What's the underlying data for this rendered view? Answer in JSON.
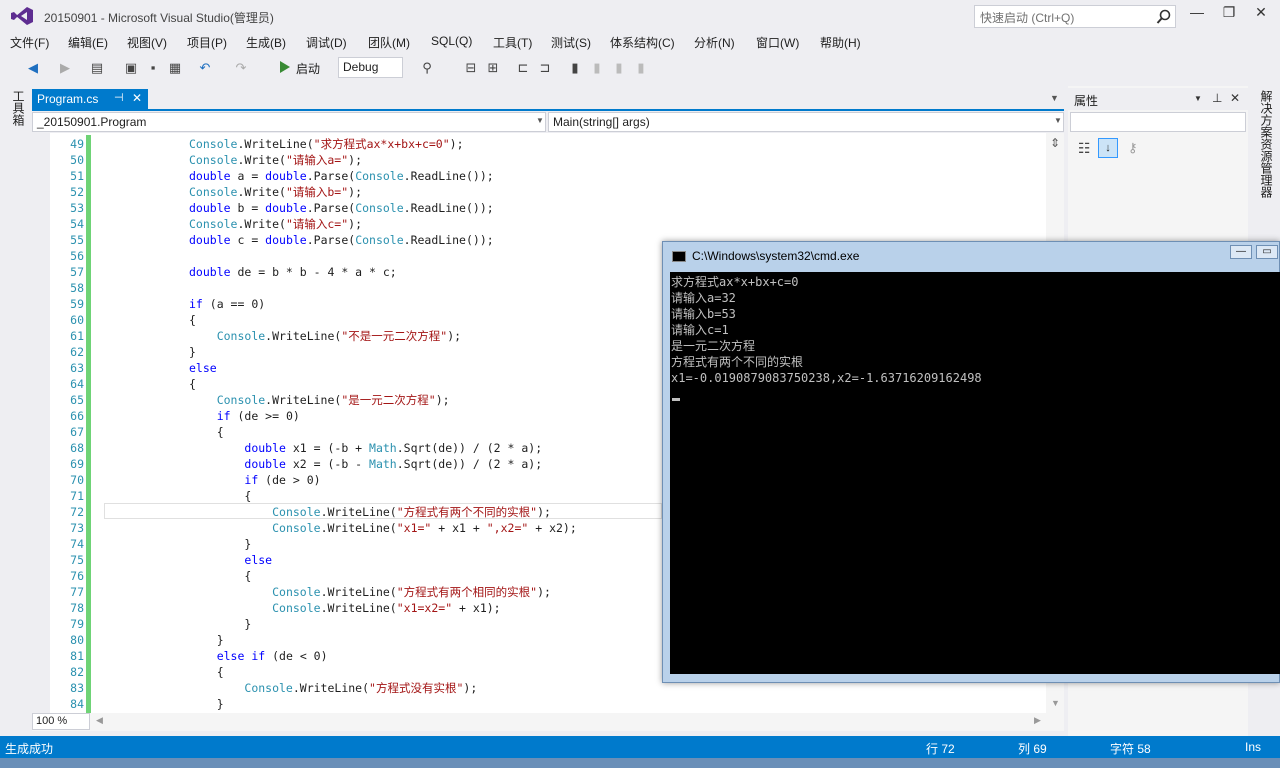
{
  "title_bar": {
    "title": "20150901 - Microsoft Visual Studio(管理员)",
    "quick_launch_placeholder": "快速启动 (Ctrl+Q)"
  },
  "menu": [
    "文件(F)",
    "编辑(E)",
    "视图(V)",
    "项目(P)",
    "生成(B)",
    "调试(D)",
    "团队(M)",
    "SQL(Q)",
    "工具(T)",
    "测试(S)",
    "体系结构(C)",
    "分析(N)",
    "窗口(W)",
    "帮助(H)"
  ],
  "toolbar": {
    "start_label": "启动",
    "config": "Debug"
  },
  "toolbox_label": "工具箱",
  "tab": {
    "label": "Program.cs"
  },
  "nav": {
    "left": "_20150901.Program",
    "right": "Main(string[] args)"
  },
  "editor": {
    "zoom": "100 %",
    "lines": [
      {
        "n": "49",
        "code": "Console.WriteLine(\"求方程式ax*x+bx+c=0\");"
      },
      {
        "n": "50",
        "code": "Console.Write(\"请输入a=\");"
      },
      {
        "n": "51",
        "code": "double a = double.Parse(Console.ReadLine());"
      },
      {
        "n": "52",
        "code": "Console.Write(\"请输入b=\");"
      },
      {
        "n": "53",
        "code": "double b = double.Parse(Console.ReadLine());"
      },
      {
        "n": "54",
        "code": "Console.Write(\"请输入c=\");"
      },
      {
        "n": "55",
        "code": "double c = double.Parse(Console.ReadLine());"
      },
      {
        "n": "56",
        "code": ""
      },
      {
        "n": "57",
        "code": "double de = b * b - 4 * a * c;"
      },
      {
        "n": "58",
        "code": ""
      },
      {
        "n": "59",
        "code": "if (a == 0)"
      },
      {
        "n": "60",
        "code": "{"
      },
      {
        "n": "61",
        "code": "    Console.WriteLine(\"不是一元二次方程\");"
      },
      {
        "n": "62",
        "code": "}"
      },
      {
        "n": "63",
        "code": "else"
      },
      {
        "n": "64",
        "code": "{"
      },
      {
        "n": "65",
        "code": "    Console.WriteLine(\"是一元二次方程\");"
      },
      {
        "n": "66",
        "code": "    if (de >= 0)"
      },
      {
        "n": "67",
        "code": "    {"
      },
      {
        "n": "68",
        "code": "        double x1 = (-b + Math.Sqrt(de)) / (2 * a);"
      },
      {
        "n": "69",
        "code": "        double x2 = (-b - Math.Sqrt(de)) / (2 * a);"
      },
      {
        "n": "70",
        "code": "        if (de > 0)"
      },
      {
        "n": "71",
        "code": "        {"
      },
      {
        "n": "72",
        "code": "            Console.WriteLine(\"方程式有两个不同的实根\");"
      },
      {
        "n": "73",
        "code": "            Console.WriteLine(\"x1=\" + x1 + \",x2=\" + x2);"
      },
      {
        "n": "74",
        "code": "        }"
      },
      {
        "n": "75",
        "code": "        else"
      },
      {
        "n": "76",
        "code": "        {"
      },
      {
        "n": "77",
        "code": "            Console.WriteLine(\"方程式有两个相同的实根\");"
      },
      {
        "n": "78",
        "code": "            Console.WriteLine(\"x1=x2=\" + x1);"
      },
      {
        "n": "79",
        "code": "        }"
      },
      {
        "n": "80",
        "code": "    }"
      },
      {
        "n": "81",
        "code": "    else if (de < 0)"
      },
      {
        "n": "82",
        "code": "    {"
      },
      {
        "n": "83",
        "code": "        Console.WriteLine(\"方程式没有实根\");"
      },
      {
        "n": "84",
        "code": "    }"
      }
    ]
  },
  "properties": {
    "title": "属性"
  },
  "solution_label": "解决方案资源管理器",
  "cmd": {
    "title": "C:\\Windows\\system32\\cmd.exe",
    "lines": [
      "求方程式ax*x+bx+c=0",
      "请输入a=32",
      "请输入b=53",
      "请输入c=1",
      "是一元二次方程",
      "方程式有两个不同的实根",
      "x1=-0.0190879083750238,x2=-1.63716209162498"
    ]
  },
  "status": {
    "message": "生成成功",
    "row": "行 72",
    "col": "列 69",
    "char": "字符 58",
    "mode": "Ins"
  },
  "colors": {
    "accent": "#007acc",
    "keyword": "#0000ff",
    "type": "#2b91af",
    "string": "#a31515"
  }
}
